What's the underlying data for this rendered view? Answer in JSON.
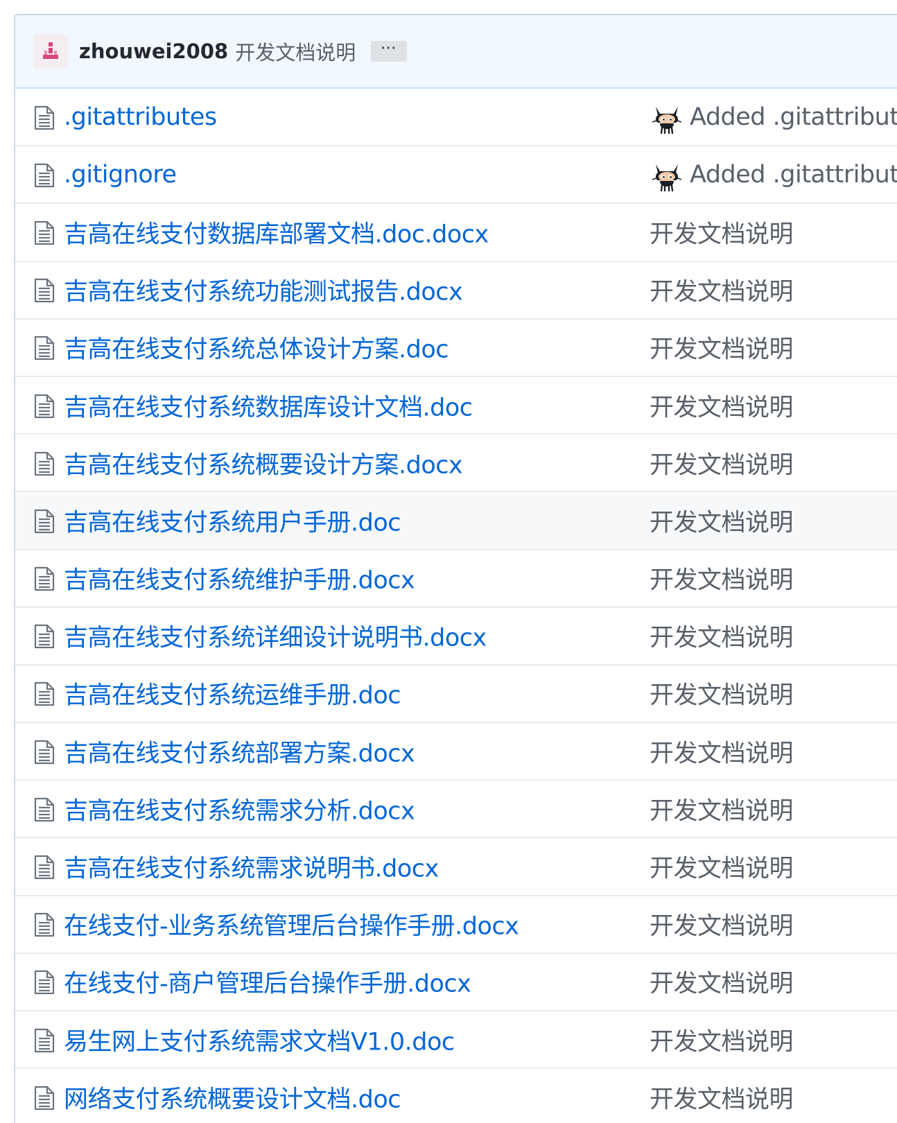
{
  "commit": {
    "author": "zhouwei2008",
    "message": "开发文档说明",
    "ellipsis": "···"
  },
  "files": [
    {
      "name": ".gitattributes",
      "commit": "Added .gitattributu",
      "avatar": "octocat-icon"
    },
    {
      "name": ".gitignore",
      "commit": "Added .gitattributu",
      "avatar": "octocat-icon"
    },
    {
      "name": "吉高在线支付数据库部署文档.doc.docx",
      "commit": "开发文档说明"
    },
    {
      "name": "吉高在线支付系统功能测试报告.docx",
      "commit": "开发文档说明"
    },
    {
      "name": "吉高在线支付系统总体设计方案.doc",
      "commit": "开发文档说明"
    },
    {
      "name": "吉高在线支付系统数据库设计文档.doc",
      "commit": "开发文档说明"
    },
    {
      "name": "吉高在线支付系统概要设计方案.docx",
      "commit": "开发文档说明"
    },
    {
      "name": "吉高在线支付系统用户手册.doc",
      "commit": "开发文档说明",
      "hover": true
    },
    {
      "name": "吉高在线支付系统维护手册.docx",
      "commit": "开发文档说明"
    },
    {
      "name": "吉高在线支付系统详细设计说明书.docx",
      "commit": "开发文档说明"
    },
    {
      "name": "吉高在线支付系统运维手册.doc",
      "commit": "开发文档说明"
    },
    {
      "name": "吉高在线支付系统部署方案.docx",
      "commit": "开发文档说明"
    },
    {
      "name": "吉高在线支付系统需求分析.docx",
      "commit": "开发文档说明"
    },
    {
      "name": "吉高在线支付系统需求说明书.docx",
      "commit": "开发文档说明"
    },
    {
      "name": "在线支付-业务系统管理后台操作手册.docx",
      "commit": "开发文档说明"
    },
    {
      "name": "在线支付-商户管理后台操作手册.docx",
      "commit": "开发文档说明"
    },
    {
      "name": "易生网上支付系统需求文档V1.0.doc",
      "commit": "开发文档说明"
    },
    {
      "name": "网络支付系统概要设计文档.doc",
      "commit": "开发文档说明"
    }
  ],
  "colors": {
    "link": "#0366d6",
    "muted": "#586069",
    "header_bg": "#f1f8ff"
  }
}
